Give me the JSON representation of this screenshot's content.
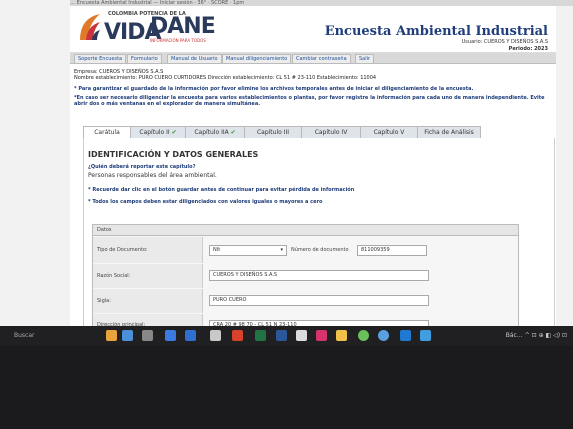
{
  "browser": {
    "strip_text": "… Encuesta Ambiental Industrial — Iniciar sesión · 36° · SCORE · 1pm"
  },
  "brand": {
    "small_text": "COLOMBIA POTENCIA DE LA",
    "vida": "VIDA",
    "dane": "DANE",
    "dane_sub": "INFORMACIÓN PARA TODOS"
  },
  "header": {
    "title": "Encuesta Ambiental Industrial",
    "user": "Usuario: CUEROS Y DISEÑOS S.A.S",
    "period": "Periodo: 2023"
  },
  "menu": {
    "items": [
      "Soporte Encuesta",
      "Formulario",
      "Manual de Usuario",
      "Manual diligenciamiento",
      "Cambiar contraseña",
      "Salir"
    ]
  },
  "info": {
    "empresa": "Empresa: CUEROS Y DISEÑOS S.A.S",
    "establecimiento": "Nombre establecimiento: PURO CUERO CURTIDORES Dirección establecimiento: CL 51 # 23-110 Establecimiento: 11004"
  },
  "notes": {
    "note1": "* Para garantizar el guardado de la información por favor elimine los archivos temporales antes de iniciar el diligenciamiento de la encuesta.",
    "note2": "*En caso ser necesario diligenciar la encuesta para varios establecimientos o plantas, por favor registre la información para cada uno de manera independiente. Evite abrir dos o más ventanas en el explorador de manera simultánea."
  },
  "tabs": [
    {
      "label": "Carátula",
      "check": ""
    },
    {
      "label": "Capítulo II",
      "check": "✔"
    },
    {
      "label": "Capítulo IIA",
      "check": "✔"
    },
    {
      "label": "Capítulo III",
      "check": ""
    },
    {
      "label": "Capítulo IV",
      "check": ""
    },
    {
      "label": "Capítulo V",
      "check": ""
    },
    {
      "label": "Ficha de Análisis",
      "check": ""
    }
  ],
  "section": {
    "title": "IDENTIFICACIÓN Y DATOS GENERALES",
    "question": "¿Quién deberá reportar este capítulo?",
    "answer": "Personas responsables del área ambiental.",
    "tip1": "* Recuerde dar clic en el botón guardar antes de continuar para evitar pérdida de información",
    "tip2": "* Todos los campos deben estar diligenciados con valores iguales o mayores a cero"
  },
  "datos": {
    "header": "Datos",
    "tipo_doc_label": "Tipo de Documento:",
    "tipo_doc_value": "NIt",
    "num_doc_label": "Número de documento",
    "num_doc_value": "811009359",
    "razon_label": "Razón Social:",
    "razon_value": "CUEROS Y DISEÑOS S.A.S",
    "sigla_label": "Sigla:",
    "sigla_value": "PURO CUERO",
    "direccion_label": "Dirección principal:",
    "direccion_value": "CRA 20 # 98 70 - CL 51 N 23-110"
  },
  "taskbar": {
    "search": "Buscar",
    "tray": "Bác… ^ ⊡ ⊕ ◧ ◁) ⊡"
  }
}
